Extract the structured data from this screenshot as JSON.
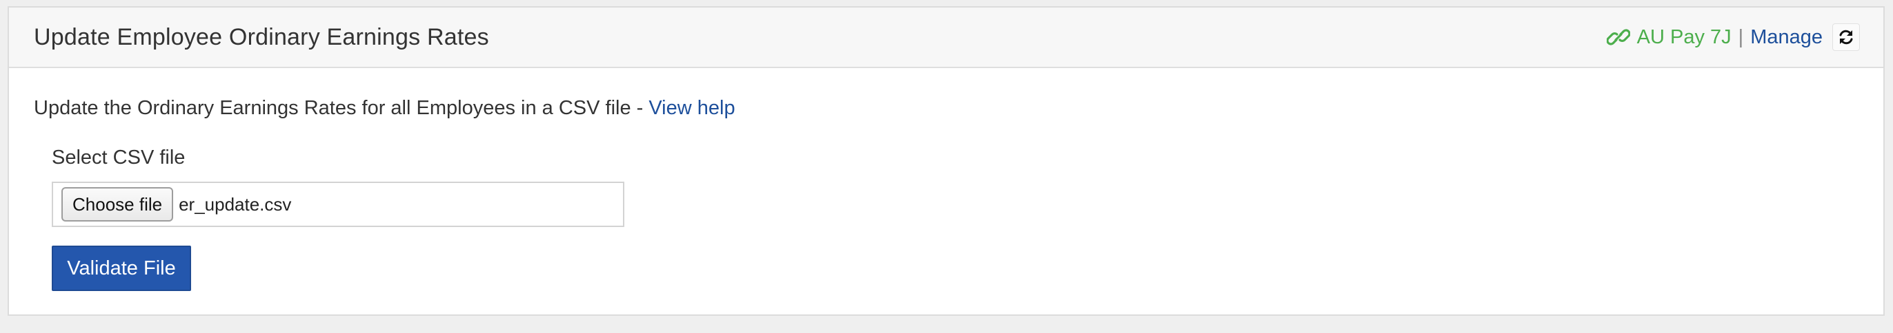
{
  "panel": {
    "title": "Update Employee Ordinary Earnings Rates",
    "header": {
      "link_icon": "link-icon",
      "connection_name": "AU Pay 7J",
      "separator": "|",
      "manage_label": "Manage",
      "refresh_icon": "refresh-icon"
    }
  },
  "description": {
    "text": "Update the Ordinary Earnings Rates for all Employees in a CSV file - ",
    "help_link": "View help"
  },
  "file_field": {
    "label": "Select CSV file",
    "choose_button": "Choose file",
    "selected_file": "er_update.csv"
  },
  "actions": {
    "validate_label": "Validate File"
  },
  "colors": {
    "accent_blue": "#2457ad",
    "link_blue": "#1d4f9b",
    "connection_green": "#4cae4c"
  }
}
